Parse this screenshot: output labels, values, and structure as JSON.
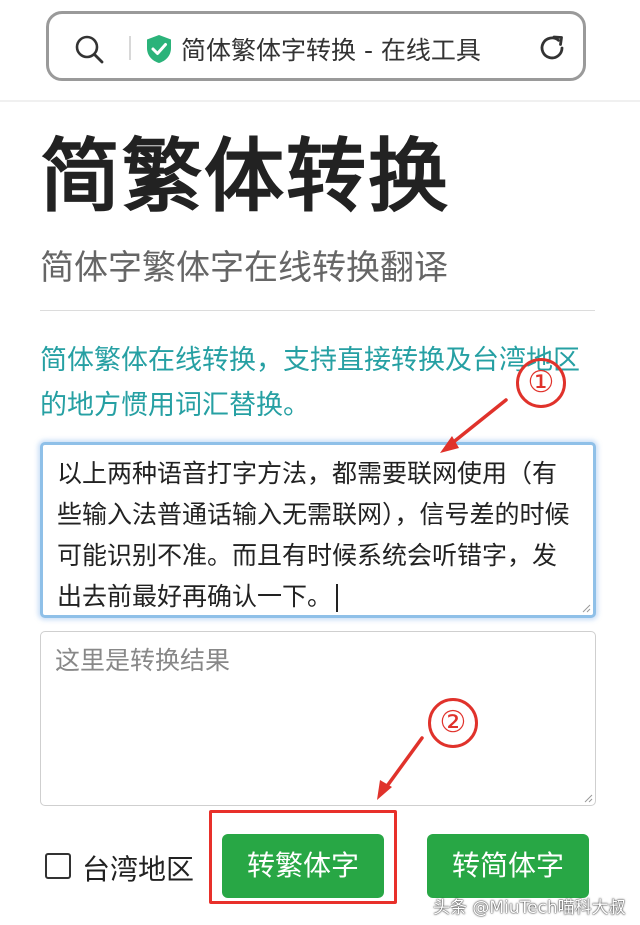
{
  "browser": {
    "url_text": "简体繁体字转换 - 在线工具",
    "icons": {
      "search": "search-icon",
      "secure": "shield-check-icon",
      "reload": "reload-icon"
    },
    "secure_color": "#2bb37a"
  },
  "page": {
    "title": "简繁体转换",
    "subtitle": "简体字繁体字在线转换翻译",
    "description": "简体繁体在线转换，支持直接转换及台湾地区的地方惯用词汇替换。",
    "accent_color": "#26a0a3"
  },
  "input": {
    "value": "以上两种语音打字方法，都需要联网使用（有些输入法普通话输入无需联网），信号差的时候可能识别不准。而且有时候系统会听错字，发出去前最好再确认一下。"
  },
  "output": {
    "placeholder": "这里是转换结果"
  },
  "controls": {
    "taiwan_checkbox_label": "台湾地区",
    "taiwan_checked": false,
    "to_traditional_label": "转繁体字",
    "to_simplified_label": "转简体字",
    "button_color": "#28a745"
  },
  "annotations": {
    "marker_1": "①",
    "marker_2": "②",
    "marker_color": "#e0322b"
  },
  "watermark": "头条 @MiuTech喵科大叔"
}
